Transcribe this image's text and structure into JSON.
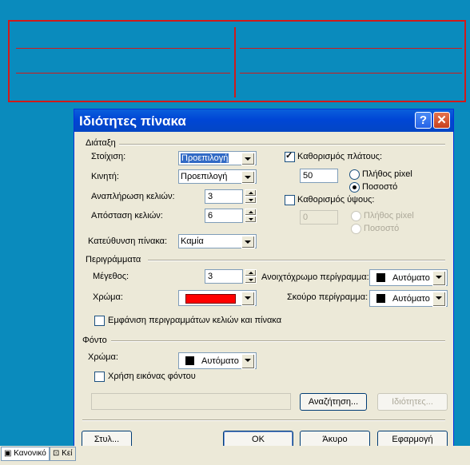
{
  "dialog": {
    "title": "Ιδιότητες πίνακα",
    "help": "?",
    "close": "✕",
    "layout": {
      "group_label": "Διάταξη",
      "alignment_label": "Στοίχιση:",
      "alignment_value": "Προεπιλογή",
      "float_label": "Κινητή:",
      "float_value": "Προεπιλογή",
      "cell_padding_label": "Αναπλήρωση κελιών:",
      "cell_padding_value": "3",
      "cell_spacing_label": "Απόσταση κελιών:",
      "cell_spacing_value": "6",
      "direction_label": "Κατεύθυνση πίνακα:",
      "direction_value": "Καμία",
      "specify_width_label": "Καθορισμός πλάτους:",
      "width_value": "50",
      "width_pixels_label": "Πλήθος pixel",
      "width_percent_label": "Ποσοστό",
      "specify_height_label": "Καθορισμός ύψους:",
      "height_value": "0",
      "height_pixels_label": "Πλήθος pixel",
      "height_percent_label": "Ποσοστό"
    },
    "borders": {
      "group_label": "Περιγράμματα",
      "size_label": "Μέγεθος:",
      "size_value": "3",
      "color_label": "Χρώμα:",
      "color_value": "#ff0000",
      "light_border_label": "Ανοιχτόχρωμο περίγραμμα:",
      "light_border_value": "Αυτόματο",
      "dark_border_label": "Σκούρο περίγραμμα:",
      "dark_border_value": "Αυτόματο",
      "show_borders_label": "Εμφάνιση περιγραμμάτων κελιών και πίνακα"
    },
    "background": {
      "group_label": "Φόντο",
      "color_label": "Χρώμα:",
      "color_value": "Αυτόματο",
      "use_image_label": "Χρήση εικόνας φόντου",
      "image_path": "",
      "browse_button": "Αναζήτηση...",
      "properties_button": "Ιδιότητες..."
    },
    "footer": {
      "style_button": "Στυλ...",
      "ok_button": "OK",
      "cancel_button": "Άκυρο",
      "apply_button": "Εφαρμογή"
    }
  },
  "status_bar": {
    "tab_normal": "Κανονικό",
    "tab_html": "Κεί"
  }
}
